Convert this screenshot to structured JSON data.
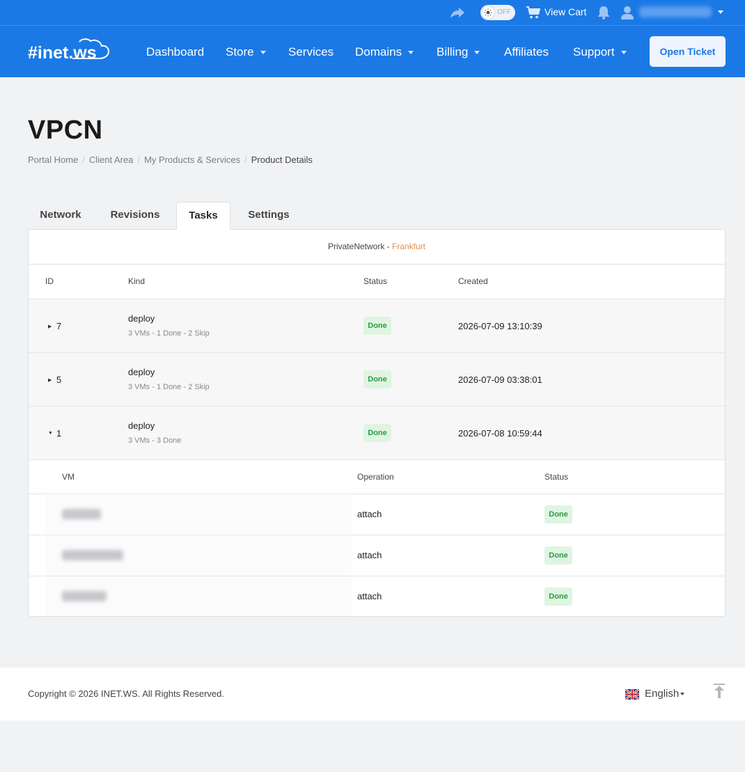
{
  "topbar": {
    "theme_toggle_label": "OFF",
    "cart_label": "View Cart"
  },
  "nav": {
    "logo_text": "#inet.ws",
    "items": [
      {
        "label": "Dashboard"
      },
      {
        "label": "Store"
      },
      {
        "label": "Services"
      },
      {
        "label": "Domains"
      },
      {
        "label": "Billing"
      },
      {
        "label": "Affiliates"
      },
      {
        "label": "Support"
      }
    ],
    "open_ticket_label": "Open Ticket"
  },
  "page": {
    "title": "VPCN",
    "breadcrumb": [
      "Portal Home",
      "Client Area",
      "My Products & Services",
      "Product Details"
    ]
  },
  "tabs": [
    "Network",
    "Revisions",
    "Tasks",
    "Settings"
  ],
  "panel": {
    "network_name": "PrivateNetwork",
    "separator": " - ",
    "location": "Frankfurt"
  },
  "tasks_table": {
    "headers": [
      "ID",
      "Kind",
      "Status",
      "Created"
    ],
    "rows": [
      {
        "id": "7",
        "kind": "deploy",
        "summary": "3 VMs - 1 Done - 2 Skip",
        "status": "Done",
        "created": "2026-07-09 13:10:39",
        "expanded": false
      },
      {
        "id": "5",
        "kind": "deploy",
        "summary": "3 VMs - 1 Done - 2 Skip",
        "status": "Done",
        "created": "2026-07-09 03:38:01",
        "expanded": false
      },
      {
        "id": "1",
        "kind": "deploy",
        "summary": "3 VMs - 3 Done",
        "status": "Done",
        "created": "2026-07-08 10:59:44",
        "expanded": true
      }
    ]
  },
  "subtasks_table": {
    "headers": [
      "VM",
      "Operation",
      "Status"
    ],
    "rows": [
      {
        "operation": "attach",
        "status": "Done"
      },
      {
        "operation": "attach",
        "status": "Done"
      },
      {
        "operation": "attach",
        "status": "Done"
      }
    ]
  },
  "footer": {
    "copyright": "Copyright © 2026 INET.WS. All Rights Reserved.",
    "language": "English"
  },
  "colors": {
    "brand_blue": "#1b79e6",
    "location_orange": "#f08b3a",
    "done_green": "#2c9c45",
    "done_bg": "#dff5e1"
  }
}
